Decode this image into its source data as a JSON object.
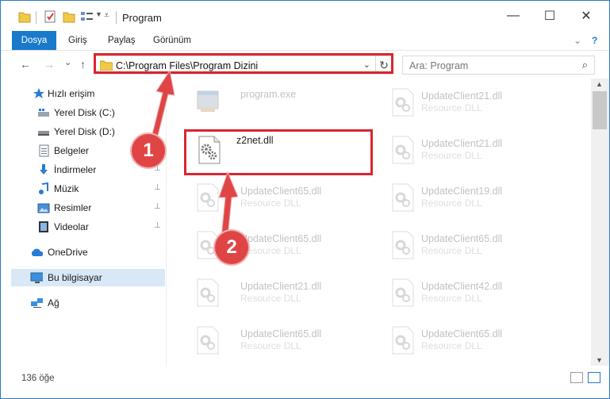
{
  "window": {
    "title": "Program",
    "minimize": "—",
    "maximize": "☐",
    "close": "✕"
  },
  "ribbon": {
    "tabs": [
      "Dosya",
      "Giriş",
      "Paylaş",
      "Görünüm"
    ],
    "expand": "⌄",
    "help": "?"
  },
  "nav": {
    "back": "←",
    "forward": "→",
    "recent": "⌄",
    "up": "↑",
    "address": "C:\\Program Files\\Program Dizini",
    "address_dropdown": "⌄",
    "refresh": "↻",
    "search_placeholder": "Ara: Program",
    "search_icon": "⌕"
  },
  "sidebar": {
    "pin": "📌",
    "items": [
      {
        "label": "Hızlı erişim",
        "icon": "star-icon"
      },
      {
        "label": "Yerel Disk (C:)",
        "icon": "drive-icon"
      },
      {
        "label": "Yerel Disk (D:)",
        "icon": "drive-icon"
      },
      {
        "label": "Belgeler",
        "icon": "documents-icon"
      },
      {
        "label": "İndirmeler",
        "icon": "download-icon"
      },
      {
        "label": "Müzik",
        "icon": "music-icon"
      },
      {
        "label": "Resimler",
        "icon": "pictures-icon"
      },
      {
        "label": "Videolar",
        "icon": "video-icon"
      },
      {
        "label": "OneDrive",
        "icon": "cloud-icon"
      },
      {
        "label": "Bu bilgisayar",
        "icon": "computer-icon"
      },
      {
        "label": "Ağ",
        "icon": "network-icon"
      }
    ]
  },
  "files": {
    "left": [
      {
        "name": "program.exe",
        "type": ""
      },
      {
        "name": "z2net.dll",
        "type": ""
      },
      {
        "name": "UpdateClient65.dll",
        "type": "Resource DLL"
      },
      {
        "name": "UpdateClient65.dll",
        "type": "Resource DLL"
      },
      {
        "name": "UpdateClient21.dll",
        "type": "Resource DLL"
      },
      {
        "name": "UpdateClient65.dll",
        "type": "Resource DLL"
      }
    ],
    "right": [
      {
        "name": "UpdateClient21.dll",
        "type": "Resource DLL"
      },
      {
        "name": "UpdateClient21.dll",
        "type": "Resource DLL"
      },
      {
        "name": "UpdateClient19.dll",
        "type": "Resource DLL"
      },
      {
        "name": "UpdateClient65.dll",
        "type": "Resource DLL"
      },
      {
        "name": "UpdateClient42.dll",
        "type": "Resource DLL"
      },
      {
        "name": "UpdateClient65.dll",
        "type": "Resource DLL"
      }
    ]
  },
  "scrollbar": {
    "up": "▲",
    "down": "▼"
  },
  "status": {
    "count": "136 öğe"
  },
  "annotations": {
    "step1": "1",
    "step2": "2",
    "color": "#d9252e"
  }
}
